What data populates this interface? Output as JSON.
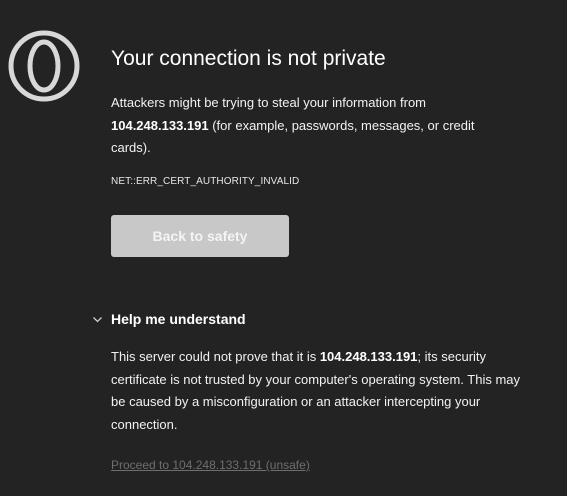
{
  "logo": {
    "icon": "opera-gx-logo-icon",
    "color": "#d8d8d8"
  },
  "heading": {
    "title": "Your connection is not private"
  },
  "description": {
    "before": "Attackers might be trying to steal your information from ",
    "host": "104.248.133.191",
    "after": " (for example, passwords, messages, or credit cards)."
  },
  "error_code": "NET::ERR_CERT_AUTHORITY_INVALID",
  "back_button": {
    "label": "Back to safety",
    "bg_color": "#c8c8c8"
  },
  "help": {
    "chevron_icon": "chevron-down-icon",
    "label": "Help me understand"
  },
  "detail": {
    "before": "This server could not prove that it is ",
    "host": "104.248.133.191",
    "after": "; its security certificate is not trusted by your computer's operating system. This may be caused by a misconfiguration or an attacker intercepting your connection."
  },
  "proceed_link": "Proceed to 104.248.133.191 (unsafe)",
  "colors": {
    "background": "#232323",
    "text": "#ffffff",
    "link_muted": "#6e6e6e"
  }
}
